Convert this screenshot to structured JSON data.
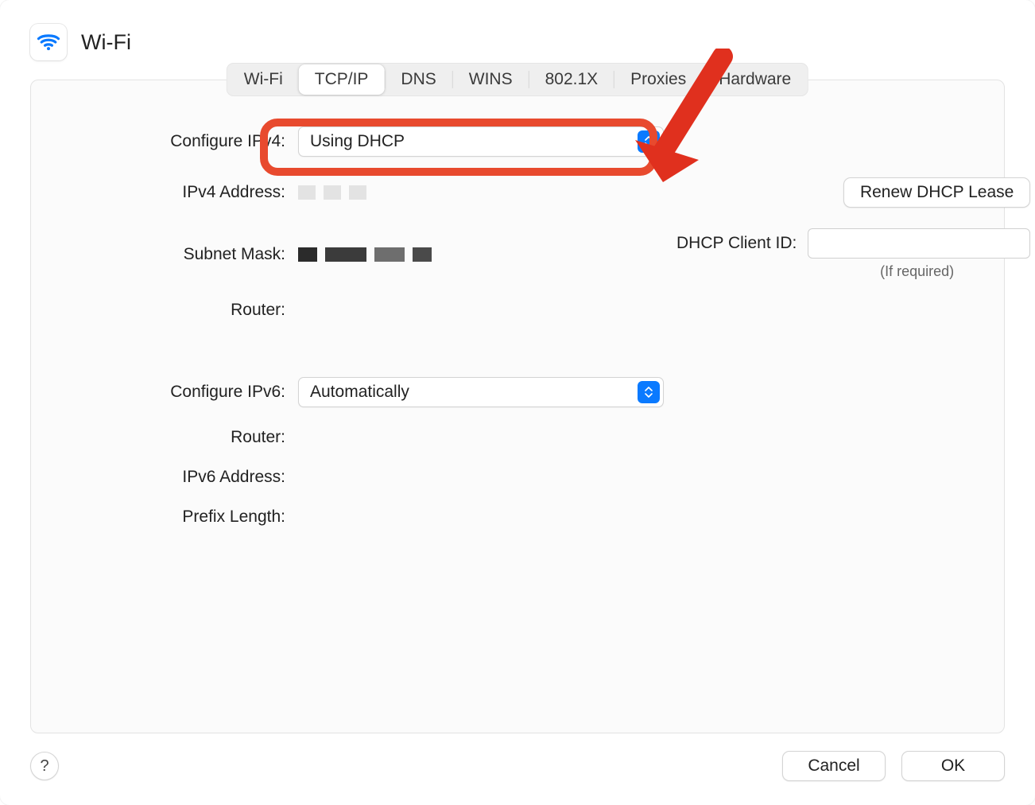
{
  "header": {
    "title": "Wi-Fi"
  },
  "tabs": {
    "wifi": "Wi-Fi",
    "tcpip": "TCP/IP",
    "dns": "DNS",
    "wins": "WINS",
    "8021x": "802.1X",
    "proxies": "Proxies",
    "hardware": "Hardware",
    "active": "tcpip"
  },
  "form": {
    "configure_ipv4_label": "Configure IPv4:",
    "configure_ipv4_value": "Using DHCP",
    "ipv4_address_label": "IPv4 Address:",
    "subnet_mask_label": "Subnet Mask:",
    "router_label": "Router:",
    "renew_lease_label": "Renew DHCP Lease",
    "dhcp_client_id_label": "DHCP Client ID:",
    "dhcp_client_id_value": "",
    "dhcp_client_hint": "(If required)",
    "configure_ipv6_label": "Configure IPv6:",
    "configure_ipv6_value": "Automatically",
    "router6_label": "Router:",
    "ipv6_address_label": "IPv6 Address:",
    "prefix_length_label": "Prefix Length:"
  },
  "footer": {
    "help": "?",
    "cancel": "Cancel",
    "ok": "OK"
  },
  "annotation": {
    "highlight_target": "configure-ipv4-select",
    "arrow_color": "#e0301e"
  }
}
